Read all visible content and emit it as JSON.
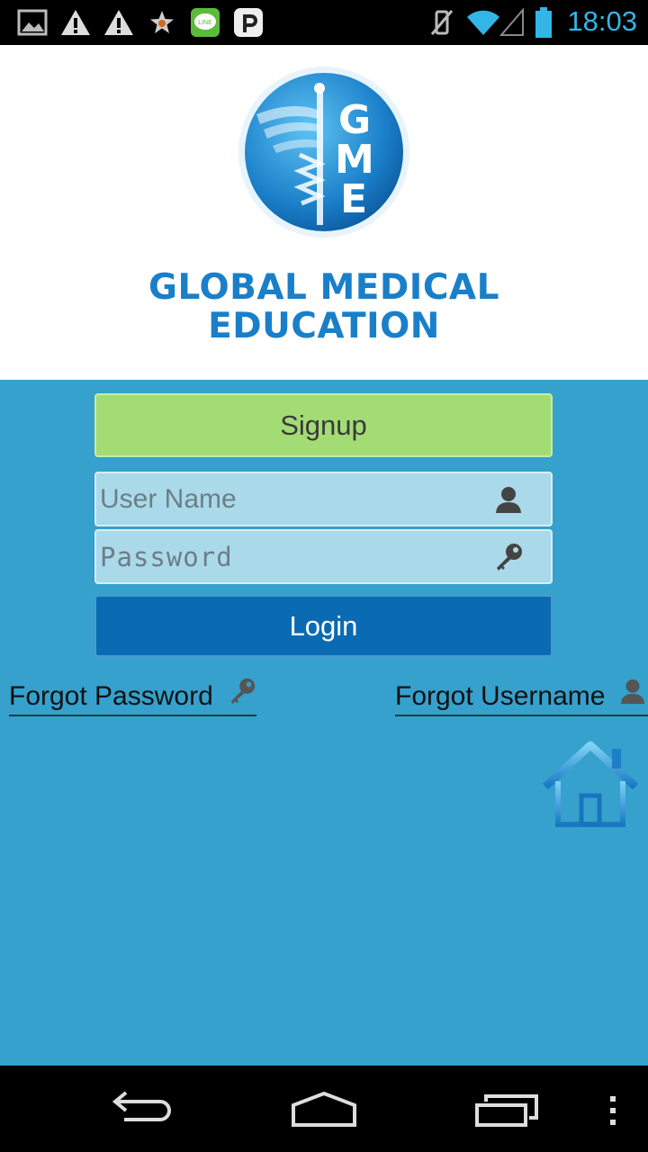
{
  "status_bar": {
    "time": "18:03",
    "left_icons": [
      "image-icon",
      "warning-icon",
      "warning-icon",
      "star-icon",
      "line-app-icon",
      "p-app-icon"
    ],
    "right_icons": [
      "vibrate-off-icon",
      "wifi-icon",
      "signal-icon",
      "battery-icon"
    ],
    "accent_color": "#33b5e5"
  },
  "header": {
    "logo_letters": [
      "G",
      "M",
      "E"
    ],
    "brand_line1": "GLOBAL MEDICAL",
    "brand_line2": "EDUCATION",
    "brand_color": "#1a7fc9"
  },
  "form": {
    "signup_label": "Signup",
    "username_placeholder": "User Name",
    "username_value": "",
    "password_placeholder": "Password",
    "password_value": "",
    "login_label": "Login"
  },
  "links": {
    "forgot_password": "Forgot Password",
    "forgot_username": "Forgot Username"
  },
  "colors": {
    "background": "#35a1cc",
    "signup": "#a3dc74",
    "login": "#0a6bb3",
    "field": "#aad9ea"
  },
  "nav_bar": {
    "icons": [
      "back-icon",
      "home-icon",
      "recents-icon",
      "menu-icon"
    ]
  }
}
